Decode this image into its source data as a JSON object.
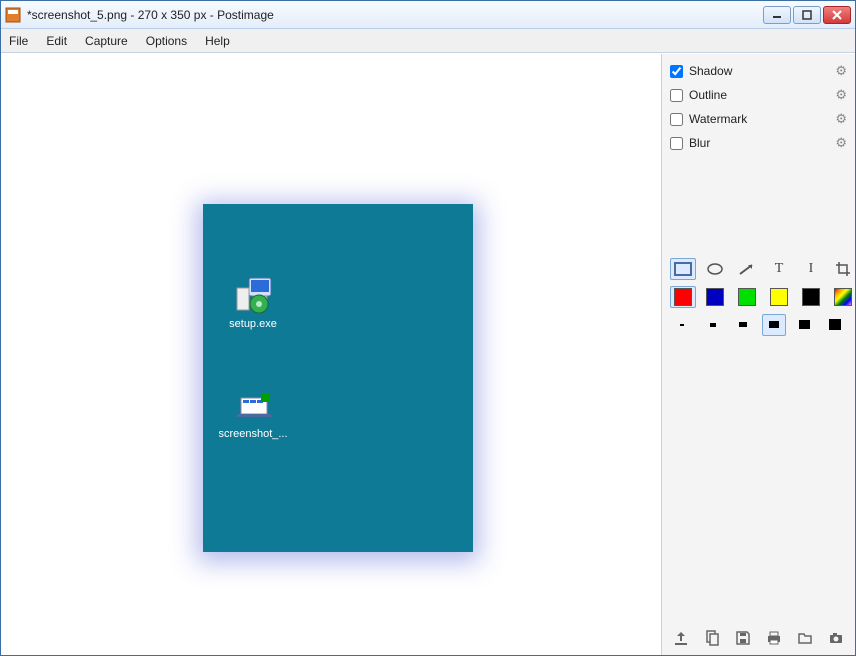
{
  "window": {
    "title": "*screenshot_5.png - 270 x 350 px - Postimage"
  },
  "menus": {
    "file": "File",
    "edit": "Edit",
    "capture": "Capture",
    "options": "Options",
    "help": "Help"
  },
  "canvas": {
    "icons": {
      "setup_label": "setup.exe",
      "screenshot_label": "screenshot_..."
    }
  },
  "effects": {
    "shadow": {
      "label": "Shadow",
      "checked": true
    },
    "outline": {
      "label": "Outline",
      "checked": false
    },
    "watermark": {
      "label": "Watermark",
      "checked": false
    },
    "blur": {
      "label": "Blur",
      "checked": false
    }
  },
  "tools": {
    "shape_rect": "rect-icon",
    "shape_ellipse": "ellipse-icon",
    "shape_arrow": "arrow-icon",
    "shape_text": "T",
    "shape_line": "I",
    "shape_crop": "crop-icon",
    "selected_shape": "rect",
    "selected_color": "#ff0000",
    "selected_thickness": 3,
    "colors": [
      "#ff0000",
      "#0000c0",
      "#00e000",
      "#ffff00",
      "#000000",
      "rainbow"
    ]
  },
  "footer": {
    "upload": "upload-icon",
    "copy": "copy-icon",
    "save": "save-icon",
    "print": "print-icon",
    "open": "open-icon",
    "camera": "camera-icon"
  }
}
